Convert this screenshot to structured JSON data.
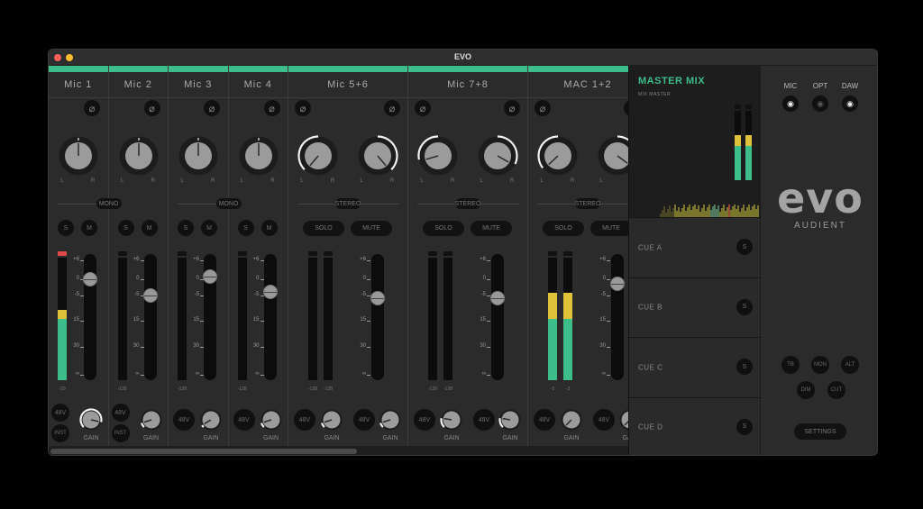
{
  "window": {
    "title": "EVO"
  },
  "colors": {
    "accent": "#3dbd8a",
    "meter_green": "#3dbd8a",
    "meter_yellow": "#e0c13a",
    "clip_red": "#e0484a",
    "close": "#fe5f57",
    "minimize": "#febc2e"
  },
  "scale_labels": [
    "+6",
    "0",
    "-5",
    "15",
    "30",
    "∞"
  ],
  "labels": {
    "left": "L",
    "right": "R",
    "solo_short": "S",
    "mute_short": "M",
    "solo": "SOLO",
    "mute": "MUTE",
    "phantom": "48V",
    "inst": "INST",
    "gain": "GAIN",
    "mono": "MONO",
    "stereo": "STEREO"
  },
  "channels": [
    {
      "name": "Mic 1",
      "type": "mono",
      "pan": [
        0
      ],
      "fader_db": 0,
      "meter": [
        0.57
      ],
      "clip": true,
      "readout": [
        "-20"
      ],
      "inst": true,
      "gain": [
        0.88
      ]
    },
    {
      "name": "Mic 2",
      "type": "mono",
      "pan": [
        0
      ],
      "fader_db": -5,
      "meter": [
        0
      ],
      "clip": false,
      "readout": [
        "-128"
      ],
      "inst": true,
      "gain": [
        0.1
      ]
    },
    {
      "name": "Mic 3",
      "type": "mono",
      "pan": [
        0
      ],
      "fader_db": 1,
      "meter": [
        0
      ],
      "clip": false,
      "readout": [
        "-128"
      ],
      "inst": false,
      "gain": [
        0.05
      ]
    },
    {
      "name": "Mic 4",
      "type": "mono",
      "pan": [
        0
      ],
      "fader_db": -4,
      "meter": [
        0
      ],
      "clip": false,
      "readout": [
        "-128"
      ],
      "inst": false,
      "gain": [
        0.1
      ]
    },
    {
      "name": "Mic 5+6",
      "type": "stereo",
      "pan": [
        -1,
        1
      ],
      "fader_db": -6,
      "meter": [
        0,
        0
      ],
      "clip": false,
      "readout": [
        "-128",
        "-128"
      ],
      "gain": [
        0.1,
        0.1
      ]
    },
    {
      "name": "Mic 7+8",
      "type": "stereo",
      "pan": [
        -0.75,
        0.85
      ],
      "fader_db": -6,
      "meter": [
        0,
        0
      ],
      "clip": false,
      "readout": [
        "-128",
        "-128"
      ],
      "gain": [
        0.2,
        0.2
      ]
    },
    {
      "name": "MAC 1+2",
      "type": "stereo",
      "pan": [
        -0.95,
        0.9
      ],
      "fader_db": -1.5,
      "meter": [
        0.71,
        0.71
      ],
      "clip": false,
      "readout": [
        "-5",
        "-3"
      ],
      "gain": [
        0,
        0
      ]
    }
  ],
  "master": {
    "title": "MASTER MIX",
    "subtitle": "MIX MASTER",
    "meter": [
      0.655,
      0.655
    ]
  },
  "cues": [
    {
      "label": "CUE A",
      "solo": "S"
    },
    {
      "label": "CUE B",
      "solo": "S"
    },
    {
      "label": "CUE C",
      "solo": "S"
    },
    {
      "label": "CUE D",
      "solo": "S"
    }
  ],
  "sources": [
    {
      "label": "MIC",
      "visible": true
    },
    {
      "label": "OPT",
      "visible": false
    },
    {
      "label": "DAW",
      "visible": true
    }
  ],
  "brand": {
    "logo": "evo",
    "name": "AUDIENT"
  },
  "monitor_buttons": [
    "TB",
    "MON",
    "ALT",
    "DIM",
    "CUT"
  ],
  "settings_label": "SETTINGS"
}
